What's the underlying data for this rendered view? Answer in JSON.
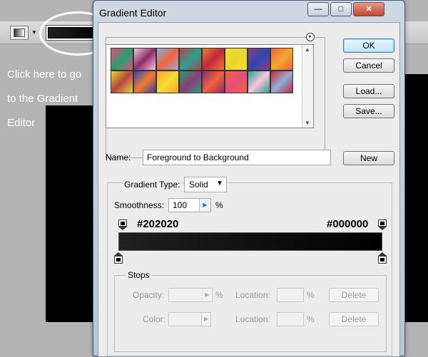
{
  "background": {
    "callout_lines": [
      "Click here to go",
      "to the Gradient",
      "Editor"
    ]
  },
  "window": {
    "title": "Gradient Editor",
    "controls": {
      "minimize": "—",
      "maximize": "□",
      "close": "✕"
    }
  },
  "presets": {
    "menu_icon": "▸",
    "colors": [
      [
        "#e64e7a",
        "#f6c5dd",
        "#8fb0d8",
        "#b44444",
        "#f47a2a",
        "#f5dd30",
        "#8c3c7c",
        "#f2623a"
      ],
      [
        "#e8d82a",
        "#3246b4",
        "#f4a82e",
        "#24a070",
        "#8c2c6c",
        "#f0643c",
        "#2ca090",
        "#c0283c"
      ]
    ]
  },
  "buttons": {
    "ok": "OK",
    "cancel": "Cancel",
    "load": "Load...",
    "save": "Save...",
    "new": "New"
  },
  "name": {
    "label": "Name:",
    "value": "Foreground to Background"
  },
  "gradient_type": {
    "label": "Gradient Type:",
    "value": "Solid"
  },
  "smoothness": {
    "label": "Smoothness:",
    "value": "100",
    "unit": "%"
  },
  "gradient": {
    "left_hex": "#202020",
    "right_hex": "#000000",
    "start_color": "#202020",
    "end_color": "#000000"
  },
  "stops": {
    "label": "Stops",
    "opacity_label": "Opacity:",
    "opacity_unit": "%",
    "color_label": "Color:",
    "location_label": "Location:",
    "location_unit": "%",
    "delete_label": "Delete"
  }
}
